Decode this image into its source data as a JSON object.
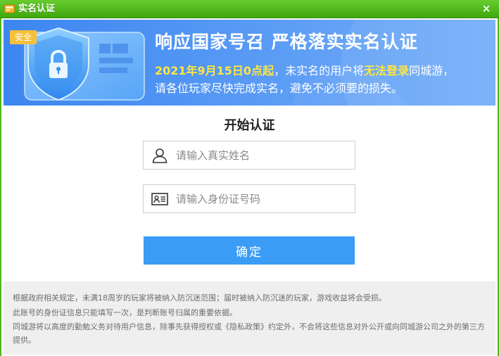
{
  "window": {
    "title": "实名认证",
    "close_glyph": "×"
  },
  "banner": {
    "badge": "安全",
    "headline": "响应国家号召 严格落实实名认证",
    "line1_date": "2021年9月15日0点起",
    "line1_mid": "，未实名的用户将",
    "line1_highlight": "无法登录",
    "line1_end": "同城游，",
    "line2": "请各位玩家尽快完成实名，避免不必须要的损失。",
    "colors": {
      "bg_start": "#3d86f0",
      "bg_end": "#74aef8",
      "highlight": "#ffe640",
      "badge": "#f6c03b"
    }
  },
  "form": {
    "title": "开始认证",
    "name_field": {
      "placeholder": "请输入真实姓名",
      "value": "",
      "icon": "user-icon"
    },
    "id_field": {
      "placeholder": "请输入身份证号码",
      "value": "",
      "icon": "id-card-icon"
    },
    "confirm_label": "确定",
    "accent": "#3b9cf6"
  },
  "notes": [
    "根据政府相关规定，未满18周岁的玩家将被纳入防沉迷范围；届时被纳入防沉迷的玩家，游戏收益将会受损。",
    "此账号的身份证信息只能填写一次，是判断账号归属的重要依据。",
    "同城游将以高度的勤勉义务对待用户信息，除事先获得授权或《隐私政策》约定外，不会将这些信息对外公开或向同城游公司之外的第三方提供。"
  ]
}
